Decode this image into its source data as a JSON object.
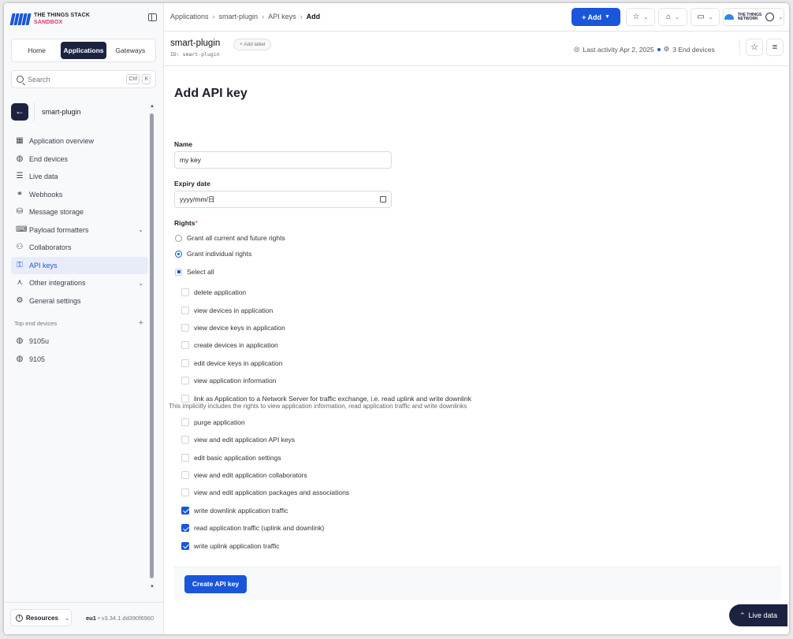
{
  "brand": {
    "line1": "THE THINGS STACK",
    "line2": "SANDBOX"
  },
  "segments": [
    {
      "label": "Home",
      "active": false
    },
    {
      "label": "Applications",
      "active": true
    },
    {
      "label": "Gateways",
      "active": false
    }
  ],
  "search": {
    "placeholder": "Search",
    "kbd1": "Ctrl",
    "kbd2": "K"
  },
  "app": {
    "name": "smart-plugin",
    "id": "ID: smart-plugin",
    "add_label": "+ Add label"
  },
  "nav": [
    {
      "label": "Application overview",
      "icon": "grid-icon"
    },
    {
      "label": "End devices",
      "icon": "device-icon"
    },
    {
      "label": "Live data",
      "icon": "list-icon"
    },
    {
      "label": "Webhooks",
      "icon": "webhook-icon"
    },
    {
      "label": "Message storage",
      "icon": "database-icon"
    },
    {
      "label": "Payload formatters",
      "icon": "formatter-icon",
      "expandable": true
    },
    {
      "label": "Collaborators",
      "icon": "users-icon"
    },
    {
      "label": "API keys",
      "icon": "key-icon",
      "active": true
    },
    {
      "label": "Other integrations",
      "icon": "integration-icon",
      "expandable": true
    },
    {
      "label": "General settings",
      "icon": "gear-icon"
    }
  ],
  "top_devices": {
    "title": "Top end devices",
    "items": [
      "9105u",
      "9105"
    ]
  },
  "footer": {
    "resources": "Resources",
    "region": "eu1",
    "version": "• v3.34.1.dd390f6960"
  },
  "breadcrumbs": [
    "Applications",
    "smart-plugin",
    "API keys",
    "Add"
  ],
  "topbar": {
    "add_label": "+ Add",
    "network_logo_line1": "THE THINGS",
    "network_logo_line2": "NETWORK"
  },
  "activity": {
    "last": "Last activity Apr 2, 2025",
    "devices": "3 End devices"
  },
  "form": {
    "title": "Add API key",
    "name_label": "Name",
    "name_value": "my key",
    "expiry_label": "Expiry date",
    "expiry_placeholder": "yyyy/mm/日",
    "rights_label": "Rights",
    "required_mark": "*",
    "grant_all": "Grant all current and future rights",
    "grant_individual": "Grant individual rights",
    "select_all": "Select all",
    "rights": [
      {
        "label": "delete application",
        "checked": false
      },
      {
        "label": "view devices in application",
        "checked": false
      },
      {
        "label": "view device keys in application",
        "checked": false
      },
      {
        "label": "create devices in application",
        "checked": false
      },
      {
        "label": "edit device keys in application",
        "checked": false
      },
      {
        "label": "view application information",
        "checked": false
      },
      {
        "label": "link as Application to a Network Server for traffic exchange, i.e. read uplink and write downlink",
        "checked": false,
        "note": "This implicitly includes the rights to view application information, read application traffic and write downlinks"
      },
      {
        "label": "purge application",
        "checked": false
      },
      {
        "label": "view and edit application API keys",
        "checked": false
      },
      {
        "label": "edit basic application settings",
        "checked": false
      },
      {
        "label": "view and edit application collaborators",
        "checked": false
      },
      {
        "label": "view and edit application packages and associations",
        "checked": false
      },
      {
        "label": "write downlink application traffic",
        "checked": true
      },
      {
        "label": "read application traffic (uplink and downlink)",
        "checked": true
      },
      {
        "label": "write uplink application traffic",
        "checked": true
      }
    ],
    "submit": "Create API key"
  },
  "live_data_button": "Live data",
  "colors": {
    "primary": "#1a56db",
    "dark": "#1c2340",
    "brand_pink": "#e0336b"
  }
}
